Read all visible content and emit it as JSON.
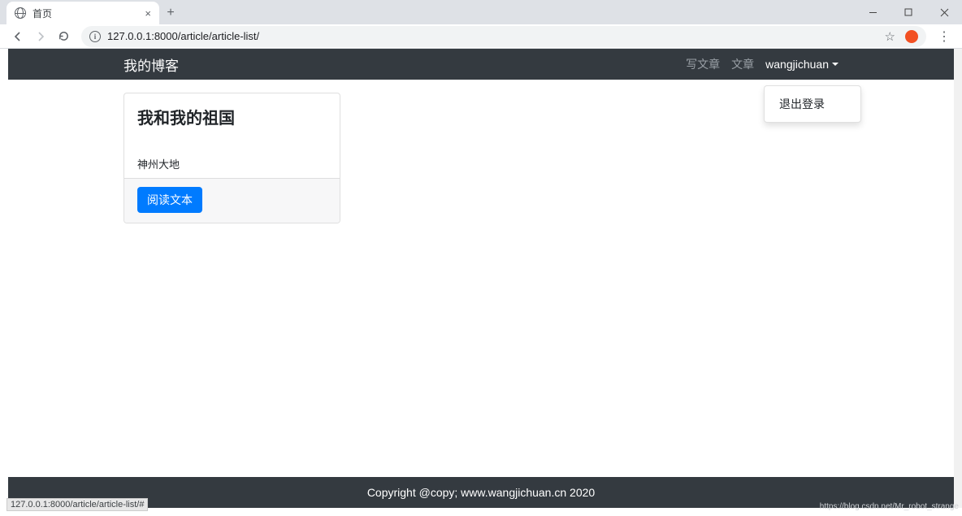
{
  "browser": {
    "tab_title": "首页",
    "url": "127.0.0.1:8000/article/article-list/",
    "status_url": "127.0.0.1:8000/article/article-list/#"
  },
  "navbar": {
    "brand": "我的博客",
    "links": {
      "write": "写文章",
      "articles": "文章"
    },
    "username": "wangjichuan",
    "dropdown": {
      "logout": "退出登录"
    }
  },
  "article": {
    "title": "我和我的祖国",
    "excerpt": "神州大地",
    "read_button": "阅读文本"
  },
  "footer": {
    "text": "Copyright @copy; www.wangjichuan.cn 2020"
  },
  "watermark": "https://blog.csdn.net/Mr_robot_strange"
}
